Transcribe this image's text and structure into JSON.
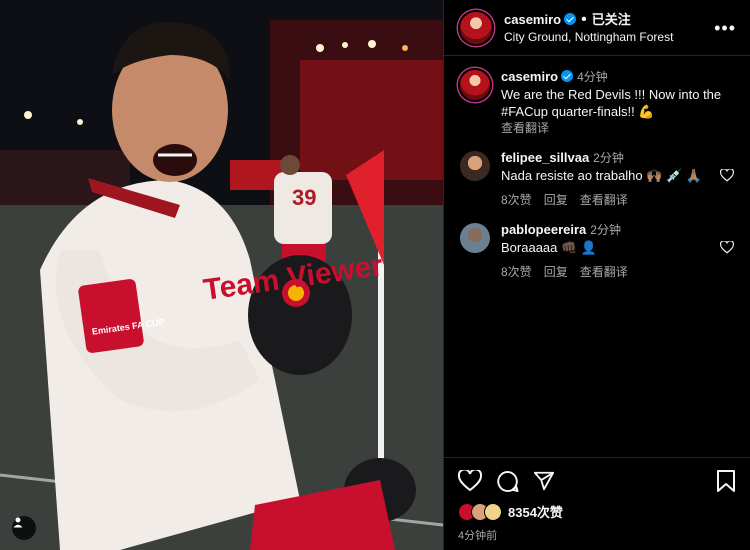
{
  "post": {
    "username": "casemiro",
    "follow_status": "已关注",
    "location": "City Ground, Nottingham Forest",
    "more_label": "•••"
  },
  "photo": {
    "shirt_sponsor": "Team Viewer",
    "badge_text": "Emirates FA CUP",
    "player_number": "39"
  },
  "caption": {
    "username": "casemiro",
    "time": "4分钟",
    "text": "We are the Red Devils !!! Now into the #FACup quarter-finals!! 💪",
    "translate_label": "查看翻译"
  },
  "comments": [
    {
      "username": "felipee_sillvaa",
      "time": "2分钟",
      "text": "Nada resiste ao trabalho 🙌🏽 💉 🙏🏽",
      "likes": "8次赞",
      "reply_label": "回复",
      "translate_label": "查看翻译"
    },
    {
      "username": "pablopeereira",
      "time": "2分钟",
      "text": "Boraaaaa 👊🏿 👤",
      "likes": "8次赞",
      "reply_label": "回复",
      "translate_label": "查看翻译"
    }
  ],
  "footer": {
    "like_count": "8354次赞",
    "posted_time": "4分钟前"
  },
  "colors": {
    "verified": "#0095f6",
    "secondary_text": "#a8a8a8",
    "kit_red": "#c8102e"
  },
  "icons": [
    "verified-badge-icon",
    "more-options-icon",
    "heart-icon",
    "comment-icon",
    "share-icon",
    "save-icon",
    "user-tag-icon"
  ]
}
